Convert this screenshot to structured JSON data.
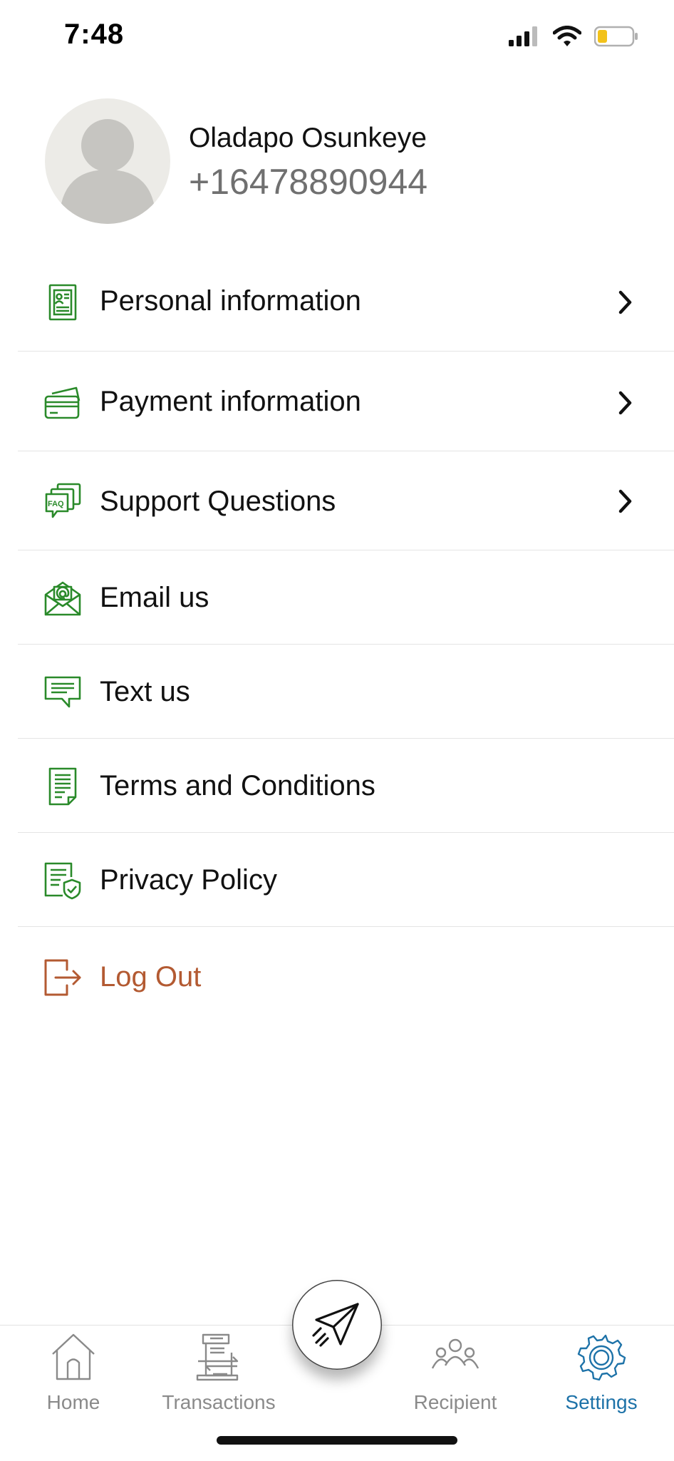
{
  "status_bar": {
    "time": "7:48",
    "icons": [
      "signal-icon",
      "wifi-icon",
      "battery-icon"
    ],
    "battery_color": "#f2c21b"
  },
  "profile": {
    "name": "Oladapo Osunkeye",
    "phone": "+16478890944"
  },
  "menu": {
    "items": [
      {
        "label": "Personal information",
        "icon": "id-card-icon",
        "has_chevron": true
      },
      {
        "label": "Payment information",
        "icon": "credit-card-icon",
        "has_chevron": true
      },
      {
        "label": "Support Questions",
        "icon": "faq-icon",
        "has_chevron": true
      },
      {
        "label": "Email us",
        "icon": "email-icon",
        "has_chevron": false
      },
      {
        "label": "Text us",
        "icon": "chat-icon",
        "has_chevron": false
      },
      {
        "label": "Terms and Conditions",
        "icon": "document-icon",
        "has_chevron": false
      },
      {
        "label": "Privacy Policy",
        "icon": "shield-document-icon",
        "has_chevron": false
      },
      {
        "label": "Log Out",
        "icon": "logout-icon",
        "has_chevron": false
      }
    ]
  },
  "bottom_nav": {
    "items": [
      {
        "label": "Home",
        "icon": "home-icon",
        "active": false
      },
      {
        "label": "Transactions",
        "icon": "transactions-icon",
        "active": false
      },
      {
        "label": "Recipient",
        "icon": "people-icon",
        "active": false
      },
      {
        "label": "Settings",
        "icon": "gear-icon",
        "active": true
      }
    ],
    "fab_icon": "paper-plane-icon"
  },
  "colors": {
    "icon_green": "#2a8a2a",
    "logout": "#b35a32",
    "active_nav": "#1d72a8",
    "inactive_nav": "#8a8a8a"
  }
}
